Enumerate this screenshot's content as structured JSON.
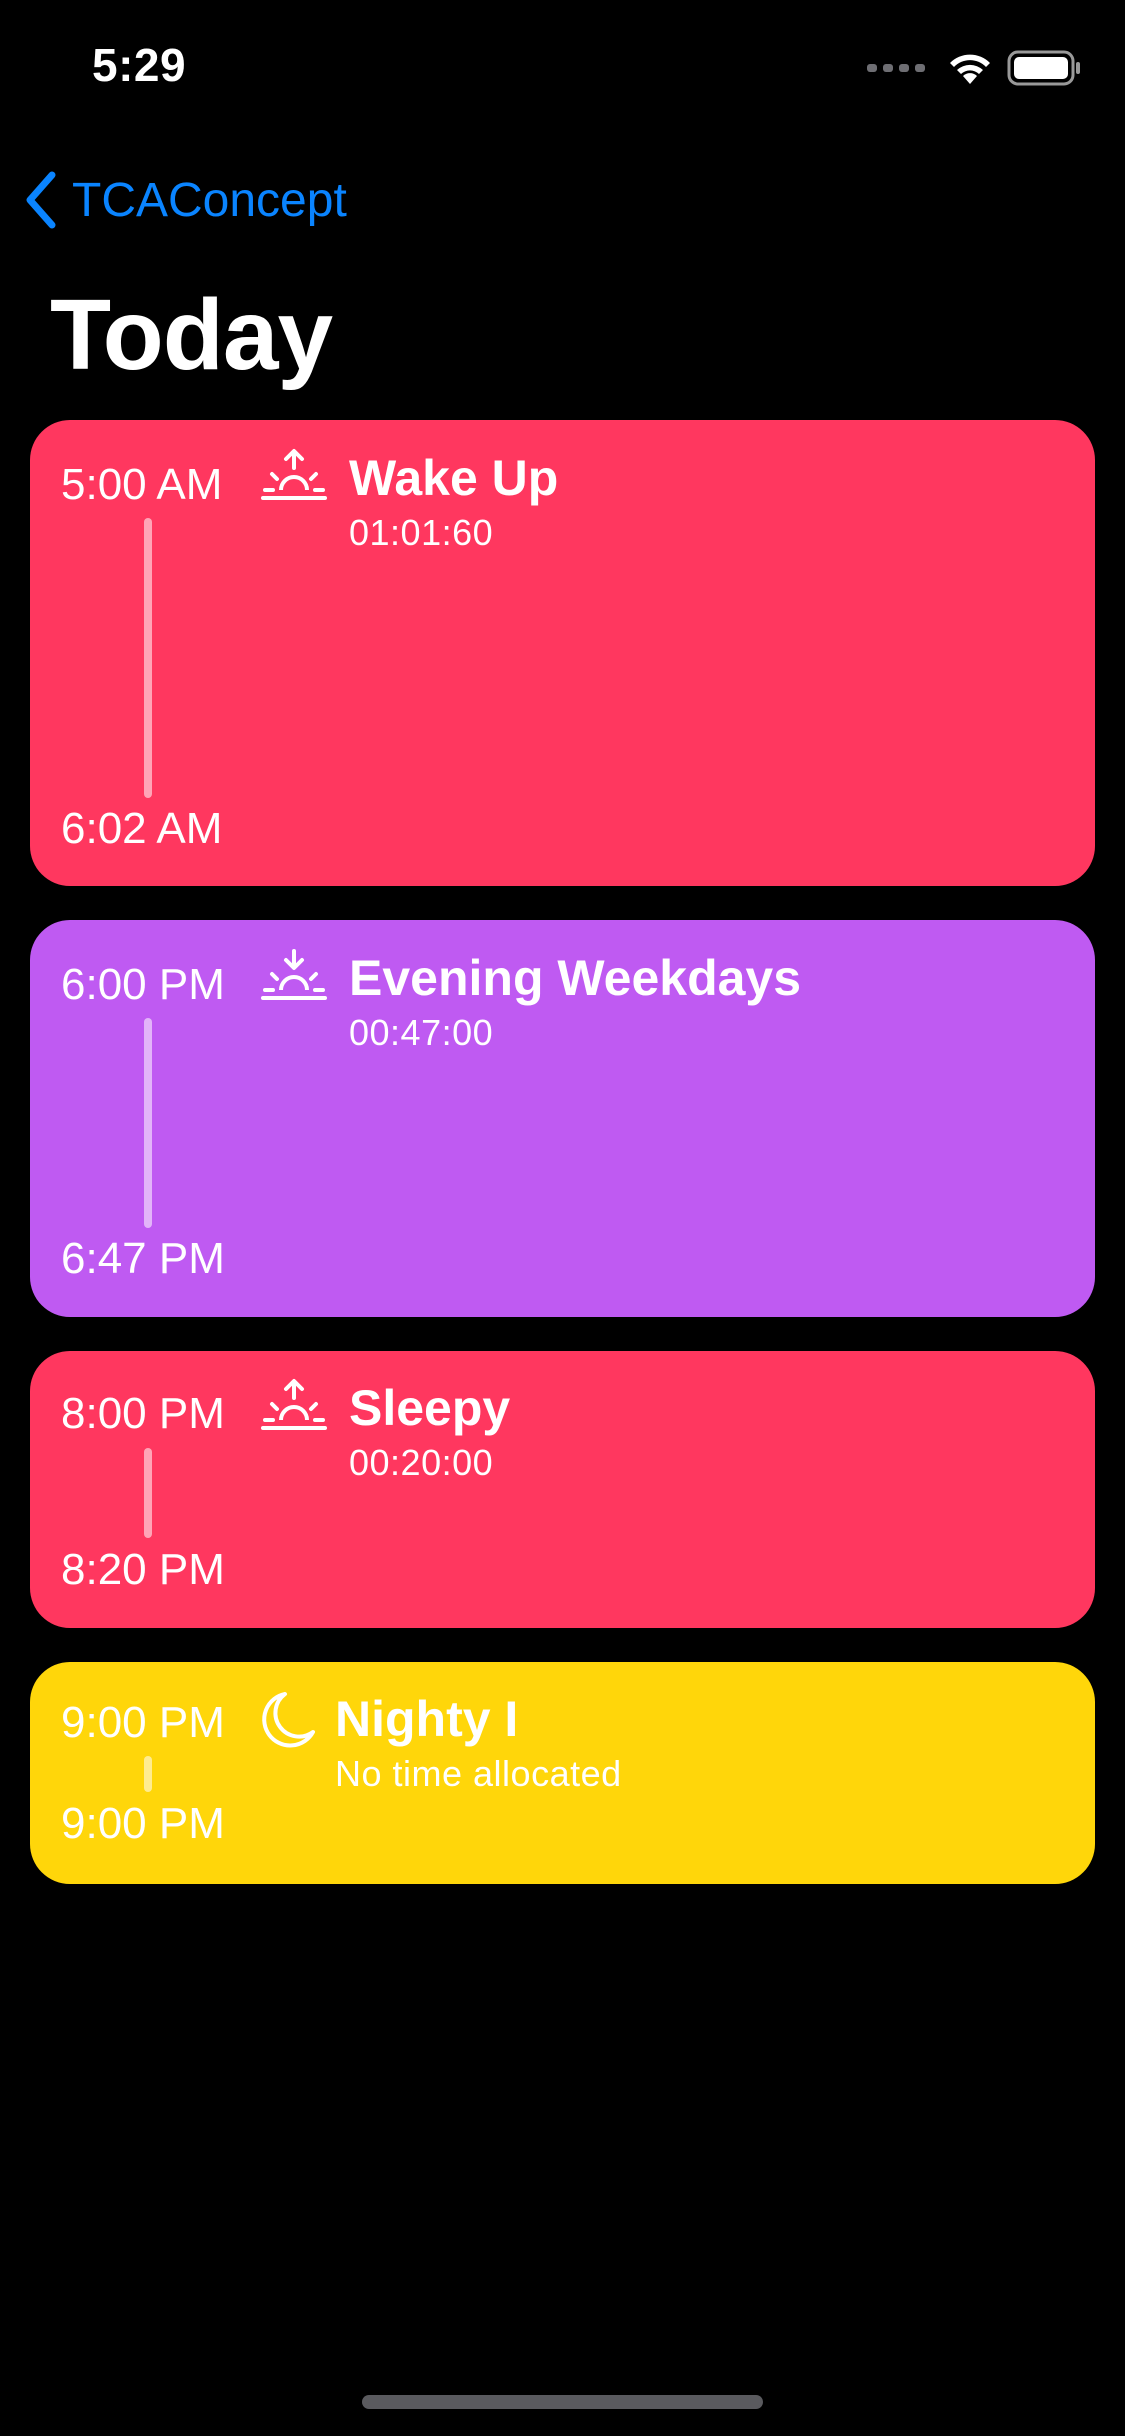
{
  "status_bar": {
    "time": "5:29"
  },
  "nav": {
    "back_label": "TCAConcept"
  },
  "page": {
    "title": "Today"
  },
  "colors": {
    "accent": "#0a84ff",
    "red_card": "#ff375f",
    "purple_card": "#bf5af2",
    "yellow_card": "#ffd60a"
  },
  "routines": [
    {
      "start": "5:00 AM",
      "end": "6:02 AM",
      "icon": "sunrise-icon",
      "title": "Wake Up",
      "duration": "01:01:60"
    },
    {
      "start": "6:00 PM",
      "end": "6:47 PM",
      "icon": "sunset-icon",
      "title": "Evening Weekdays",
      "duration": "00:47:00"
    },
    {
      "start": "8:00 PM",
      "end": "8:20 PM",
      "icon": "sunrise-icon",
      "title": "Sleepy",
      "duration": "00:20:00"
    },
    {
      "start": "9:00 PM",
      "end": "9:00 PM",
      "icon": "moon-icon",
      "title": "Nighty I",
      "duration": "No time allocated"
    }
  ]
}
